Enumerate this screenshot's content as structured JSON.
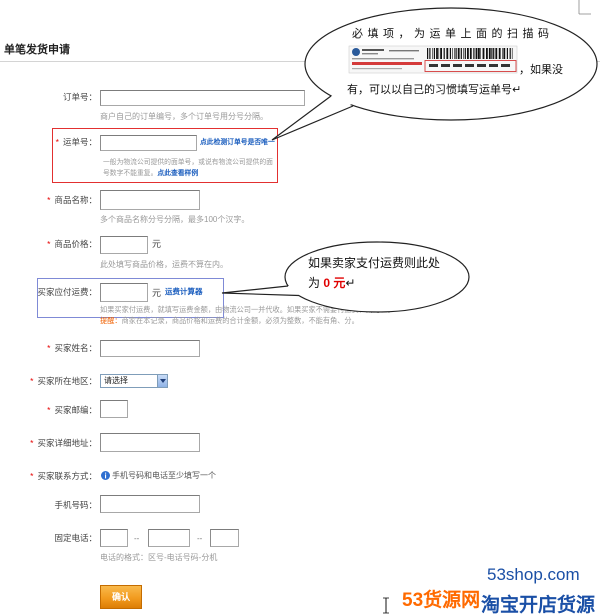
{
  "heading": "单笔发货申请",
  "form": {
    "order_no": {
      "label": "订单号：",
      "value": "",
      "help": "商户自己的订单编号，多个订单号用分号分隔。"
    },
    "waybill_no": {
      "required": "*",
      "label": "运单号：",
      "value": "",
      "check_link": "点此检测订单号是否唯一",
      "help_line1": "一般为物流公司提供的面单号，或说有物流公司提供的面",
      "help_line2": "号数字不能重复。",
      "sample_link": "点此查看样例"
    },
    "product_name": {
      "required": "*",
      "label": "商品名称：",
      "value": "",
      "help": "多个商品名称分号分隔，最多100个汉字。"
    },
    "product_price": {
      "required": "*",
      "label": "商品价格：",
      "value": "",
      "unit": "元",
      "help": "此处填写商品价格，运费不算在内。"
    },
    "shipping_fee": {
      "label": "买家应付运费：",
      "value": "",
      "unit": "元",
      "calculator_link": "运费计算器",
      "help": "如果买家付运费，就填写运费金额，由物流公司一并代收。如果买家不需要付运费，则为空。",
      "reminder_label": "提醒：",
      "reminder": "商家在本记录，商品价格和运费的合计金额，必须为整数，不能有角、分。"
    },
    "buyer_name": {
      "required": "*",
      "label": "买家姓名：",
      "value": ""
    },
    "buyer_region": {
      "required": "*",
      "label": "买家所在地区：",
      "selected": "请选择"
    },
    "buyer_postcode": {
      "required": "*",
      "label": "买家邮编：",
      "value": ""
    },
    "buyer_address": {
      "required": "*",
      "label": "买家详细地址：",
      "value": ""
    },
    "buyer_contact": {
      "required": "*",
      "label": "买家联系方式：",
      "hint_icon": "info-icon",
      "hint": "手机号码和电话至少填写一个"
    },
    "mobile": {
      "label": "手机号码：",
      "value": ""
    },
    "landline": {
      "label": "固定电话：",
      "area_code": "",
      "number": "",
      "extension": "",
      "separator": "--",
      "help": "电话的格式：区号-电话号码-分机"
    },
    "submit_label": "确认"
  },
  "callouts": {
    "waybill": {
      "line1": "必填项，为运单上面的扫描码",
      "line2": "，如果没",
      "line3": "有，可以以自己的习惯填写运单号↵"
    },
    "shipping_fee": {
      "line1": "如果卖家支付运费则此处",
      "line2_prefix": "为",
      "line2_value": " 0 元",
      "line2_suffix": "↵"
    }
  },
  "watermark": {
    "domain": "53shop.com",
    "brand": "53货源网",
    "tagline": "淘宝开店货源"
  },
  "colors": {
    "required": "#e60000",
    "link": "#1d5fbf",
    "help_text": "#9a9a9a",
    "highlight_red": "#e23030",
    "highlight_blue": "#7f8ad6",
    "button": "#f29b1f",
    "reminder": "#f06000",
    "watermark_orange": "#ff6a00",
    "watermark_blue": "#1a4fa6"
  }
}
